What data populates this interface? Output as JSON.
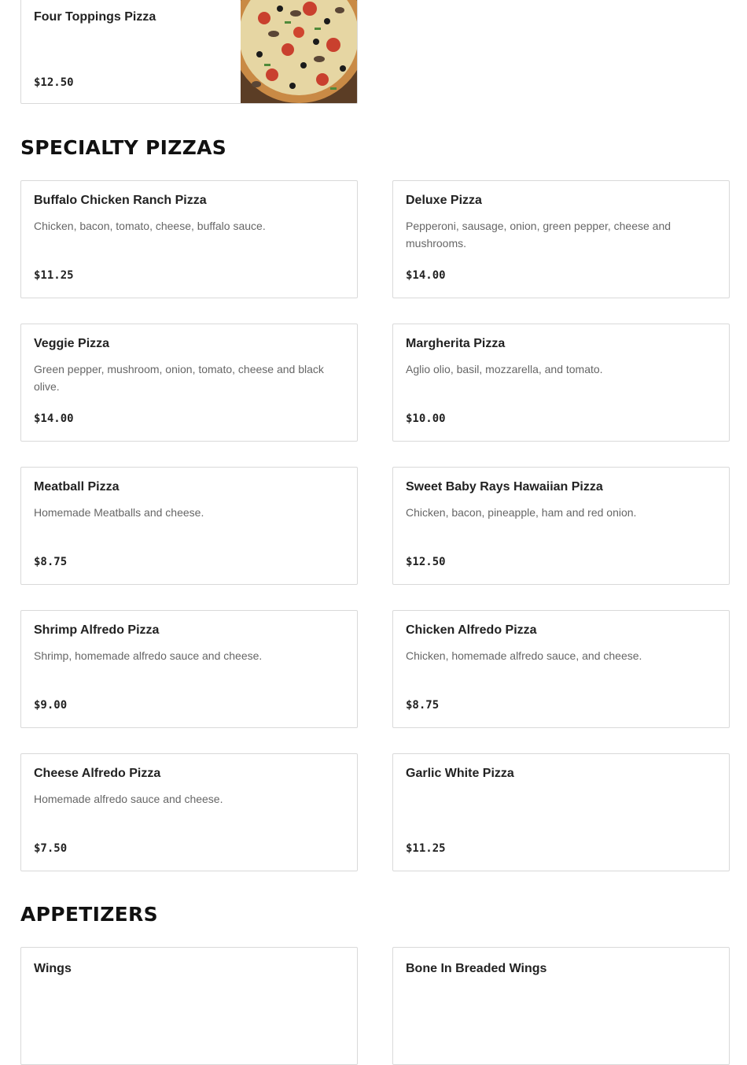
{
  "top_item": {
    "name": "Four Toppings Pizza",
    "price": "$12.50"
  },
  "specialty": {
    "title": "SPECIALTY PIZZAS",
    "items": [
      {
        "name": "Buffalo Chicken Ranch Pizza",
        "description": "Chicken, bacon, tomato, cheese, buffalo sauce.",
        "price": "$11.25"
      },
      {
        "name": "Deluxe Pizza",
        "description": "Pepperoni, sausage, onion, green pepper, cheese and mushrooms.",
        "price": "$14.00"
      },
      {
        "name": "Veggie Pizza",
        "description": "Green pepper, mushroom, onion, tomato, cheese and black olive.",
        "price": "$14.00"
      },
      {
        "name": "Margherita Pizza",
        "description": "Aglio olio, basil, mozzarella, and tomato.",
        "price": "$10.00"
      },
      {
        "name": "Meatball Pizza",
        "description": "Homemade Meatballs and cheese.",
        "price": "$8.75"
      },
      {
        "name": "Sweet Baby Rays Hawaiian Pizza",
        "description": "Chicken, bacon, pineapple, ham and red onion.",
        "price": "$12.50"
      },
      {
        "name": "Shrimp Alfredo Pizza",
        "description": "Shrimp, homemade alfredo sauce and cheese.",
        "price": "$9.00"
      },
      {
        "name": "Chicken Alfredo Pizza",
        "description": "Chicken, homemade alfredo sauce, and cheese.",
        "price": "$8.75"
      },
      {
        "name": "Cheese Alfredo Pizza",
        "description": "Homemade alfredo sauce and cheese.",
        "price": "$7.50"
      },
      {
        "name": "Garlic White Pizza",
        "description": "",
        "price": "$11.25"
      }
    ]
  },
  "appetizers": {
    "title": "APPETIZERS",
    "items": [
      {
        "name": "Wings"
      },
      {
        "name": "Bone In Breaded Wings"
      }
    ]
  }
}
